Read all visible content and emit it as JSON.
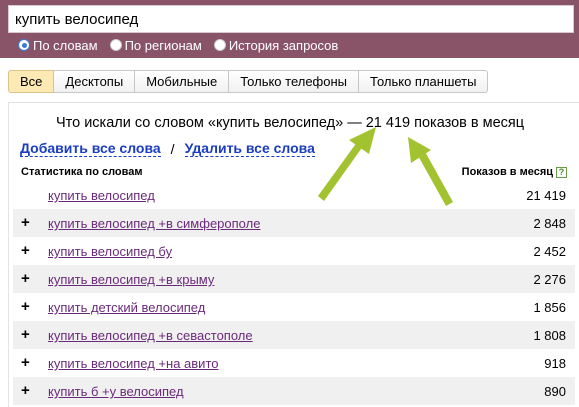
{
  "search": {
    "query": "купить велосипед"
  },
  "modes": [
    {
      "label": "По словам",
      "checked": true
    },
    {
      "label": "По регионам",
      "checked": false
    },
    {
      "label": "История запросов",
      "checked": false
    }
  ],
  "tabs": [
    {
      "label": "Все",
      "active": true
    },
    {
      "label": "Десктопы",
      "active": false
    },
    {
      "label": "Мобильные",
      "active": false
    },
    {
      "label": "Только телефоны",
      "active": false
    },
    {
      "label": "Только планшеты",
      "active": false
    }
  ],
  "summary": "Что искали со словом «купить велосипед» — 21 419 показов в месяц",
  "actions": {
    "add_all": "Добавить все слова",
    "separator": "/",
    "remove_all": "Удалить все слова"
  },
  "table": {
    "left_header": "Статистика по словам",
    "right_header": "Показов в месяц",
    "help_icon": "?",
    "rows": [
      {
        "keyword": "купить велосипед",
        "count": "21 419",
        "plus": false
      },
      {
        "keyword": "купить велосипед +в симферополе",
        "count": "2 848",
        "plus": true
      },
      {
        "keyword": "купить велосипед бу",
        "count": "2 452",
        "plus": true
      },
      {
        "keyword": "купить велосипед +в крыму",
        "count": "2 276",
        "plus": true
      },
      {
        "keyword": "купить детский велосипед",
        "count": "1 856",
        "plus": true
      },
      {
        "keyword": "купить велосипед +в севастополе",
        "count": "1 808",
        "plus": true
      },
      {
        "keyword": "купить велосипед +на авито",
        "count": "918",
        "plus": true
      },
      {
        "keyword": "купить б +у велосипед",
        "count": "890",
        "plus": true
      }
    ]
  },
  "colors": {
    "header_bg": "#8a5468",
    "active_tab": "#fce9b3",
    "link": "#1a3dc1",
    "visited_link": "#6a2a7a",
    "arrow": "#a3c230"
  }
}
